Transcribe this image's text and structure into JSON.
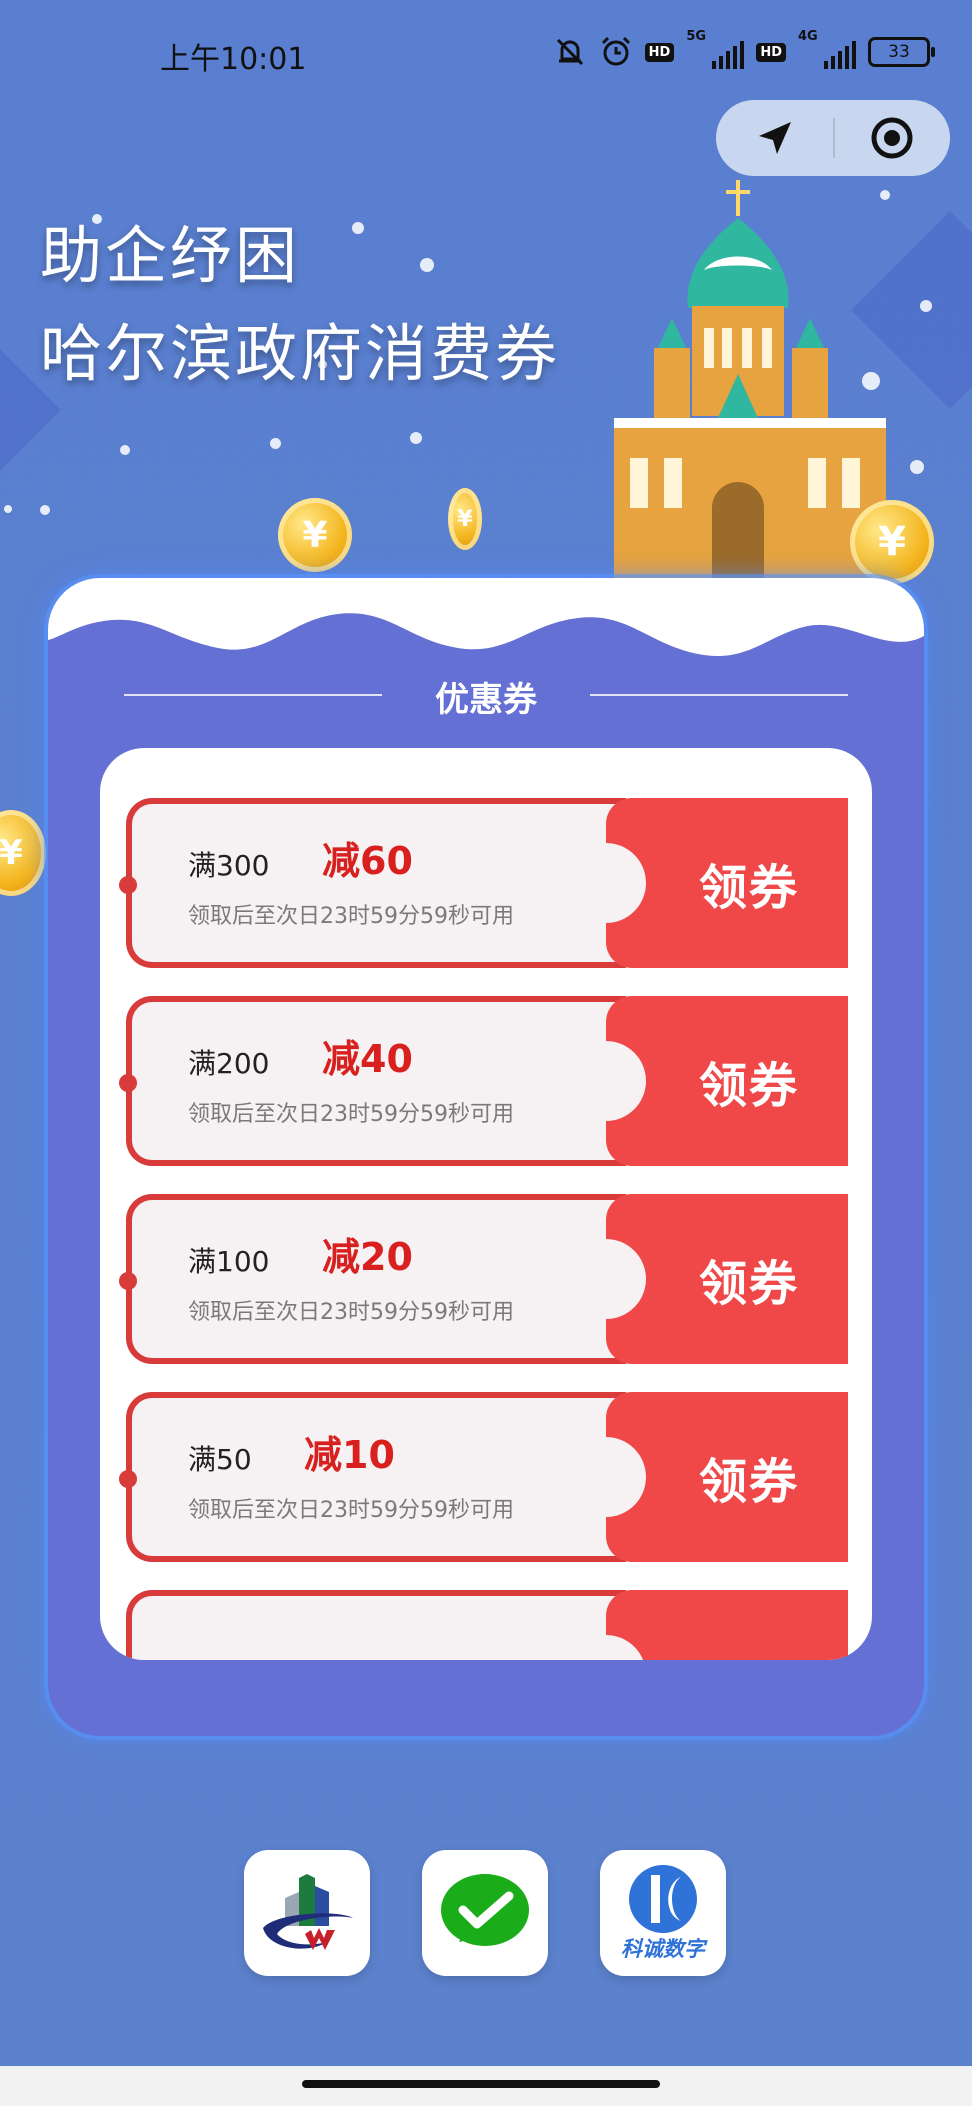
{
  "status_bar": {
    "time": "上午10:01",
    "network_1": "5G",
    "network_2": "4G",
    "hd_badge": "HD",
    "battery": "33"
  },
  "hero": {
    "line1": "助企纾困",
    "line2": "哈尔滨政府消费券"
  },
  "panel": {
    "title": "优惠券"
  },
  "coupons": [
    {
      "condition": "满300",
      "discount": "减60",
      "note": "领取后至次日23时59分59秒可用",
      "claim": "领券"
    },
    {
      "condition": "满200",
      "discount": "减40",
      "note": "领取后至次日23时59分59秒可用",
      "claim": "领券"
    },
    {
      "condition": "满100",
      "discount": "减20",
      "note": "领取后至次日23时59分59秒可用",
      "claim": "领券"
    },
    {
      "condition": "满50",
      "discount": "减10",
      "note": "领取后至次日23时59分59秒可用",
      "claim": "领券"
    }
  ],
  "partners": {
    "kecheng_label": "科诚数字"
  },
  "icons": {
    "capsule_left": "location-arrow-icon",
    "capsule_right": "target-icon",
    "partner_1": "bank-logo-icon",
    "partner_2": "wechat-pay-icon",
    "partner_3": "kecheng-digital-logo-icon"
  },
  "colors": {
    "background": "#5b80cf",
    "coupon_red": "#f04848",
    "discount_red": "#d8201f",
    "panel": "#6470d4"
  }
}
